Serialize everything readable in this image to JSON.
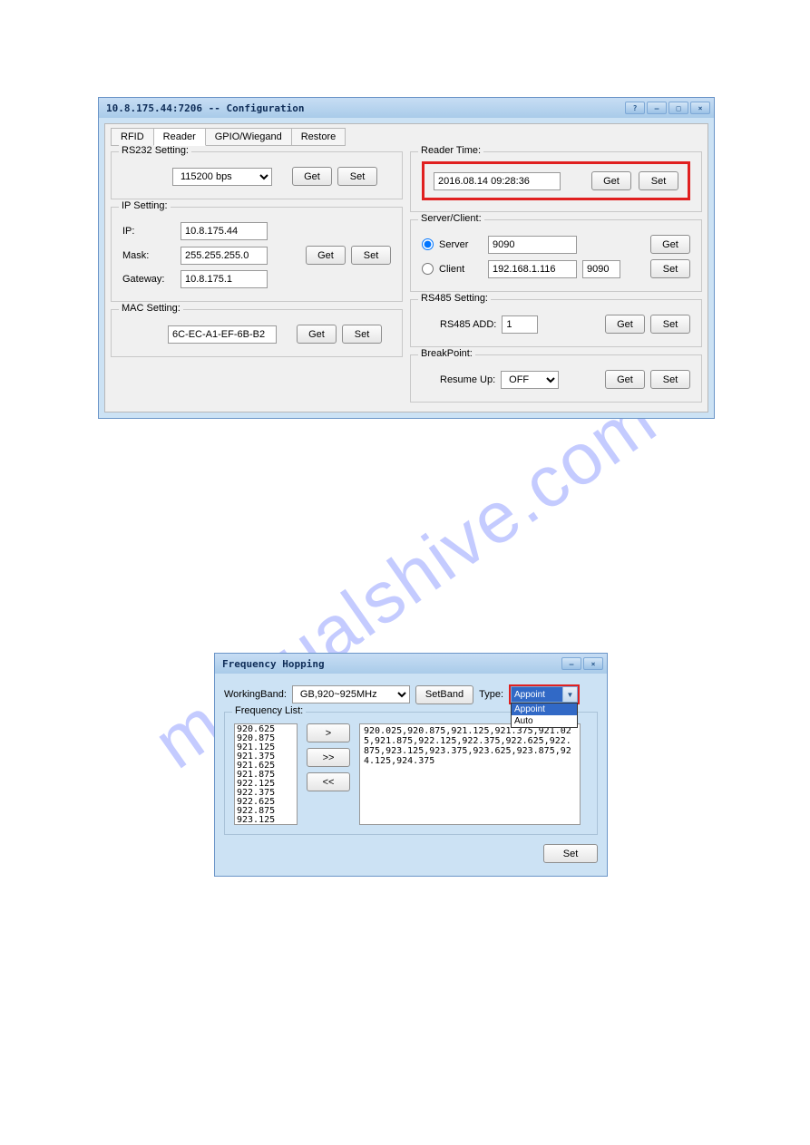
{
  "watermark": "manualshive.com",
  "config_window": {
    "title": "10.8.175.44:7206 -- Configuration",
    "tabs": {
      "rfid": "RFID",
      "reader": "Reader",
      "gpio": "GPIO/Wiegand",
      "restore": "Restore"
    },
    "rs232": {
      "title": "RS232 Setting:",
      "baud": "115200 bps",
      "get": "Get",
      "set": "Set"
    },
    "ip": {
      "title": "IP Setting:",
      "ip_lbl": "IP:",
      "ip_val": "10.8.175.44",
      "mask_lbl": "Mask:",
      "mask_val": "255.255.255.0",
      "gw_lbl": "Gateway:",
      "gw_val": "10.8.175.1",
      "get": "Get",
      "set": "Set"
    },
    "mac": {
      "title": "MAC Setting:",
      "val": "6C-EC-A1-EF-6B-B2",
      "get": "Get",
      "set": "Set"
    },
    "reader_time": {
      "title": "Reader Time:",
      "val": "2016.08.14 09:28:36",
      "get": "Get",
      "set": "Set"
    },
    "server_client": {
      "title": "Server/Client:",
      "server_lbl": "Server",
      "server_port": "9090",
      "client_lbl": "Client",
      "client_ip": "192.168.1.116",
      "client_port": "9090",
      "get": "Get",
      "set": "Set"
    },
    "rs485": {
      "title": "RS485 Setting:",
      "add_lbl": "RS485 ADD:",
      "add_val": "1",
      "get": "Get",
      "set": "Set"
    },
    "breakpoint": {
      "title": "BreakPoint:",
      "resume_lbl": "Resume Up:",
      "resume_val": "OFF",
      "get": "Get",
      "set": "Set"
    }
  },
  "freq_window": {
    "title": "Frequency Hopping",
    "band_lbl": "WorkingBand:",
    "band_val": "GB,920~925MHz",
    "setband": "SetBand",
    "type_lbl": "Type:",
    "type_sel": "Appoint",
    "type_opts": [
      "Appoint",
      "Auto"
    ],
    "list_title": "Frequency List:",
    "avail": [
      "920.625",
      "920.875",
      "921.125",
      "921.375",
      "921.625",
      "921.875",
      "922.125",
      "922.375",
      "922.625",
      "922.875",
      "923.125"
    ],
    "move": {
      "r": ">",
      "rr": ">>",
      "ll": "<<"
    },
    "selected_text": "920.025,920.875,921.125,921.375,921.025,921.875,922.125,922.375,922.625,922.875,923.125,923.375,923.625,923.875,924.125,924.375",
    "set": "Set"
  }
}
